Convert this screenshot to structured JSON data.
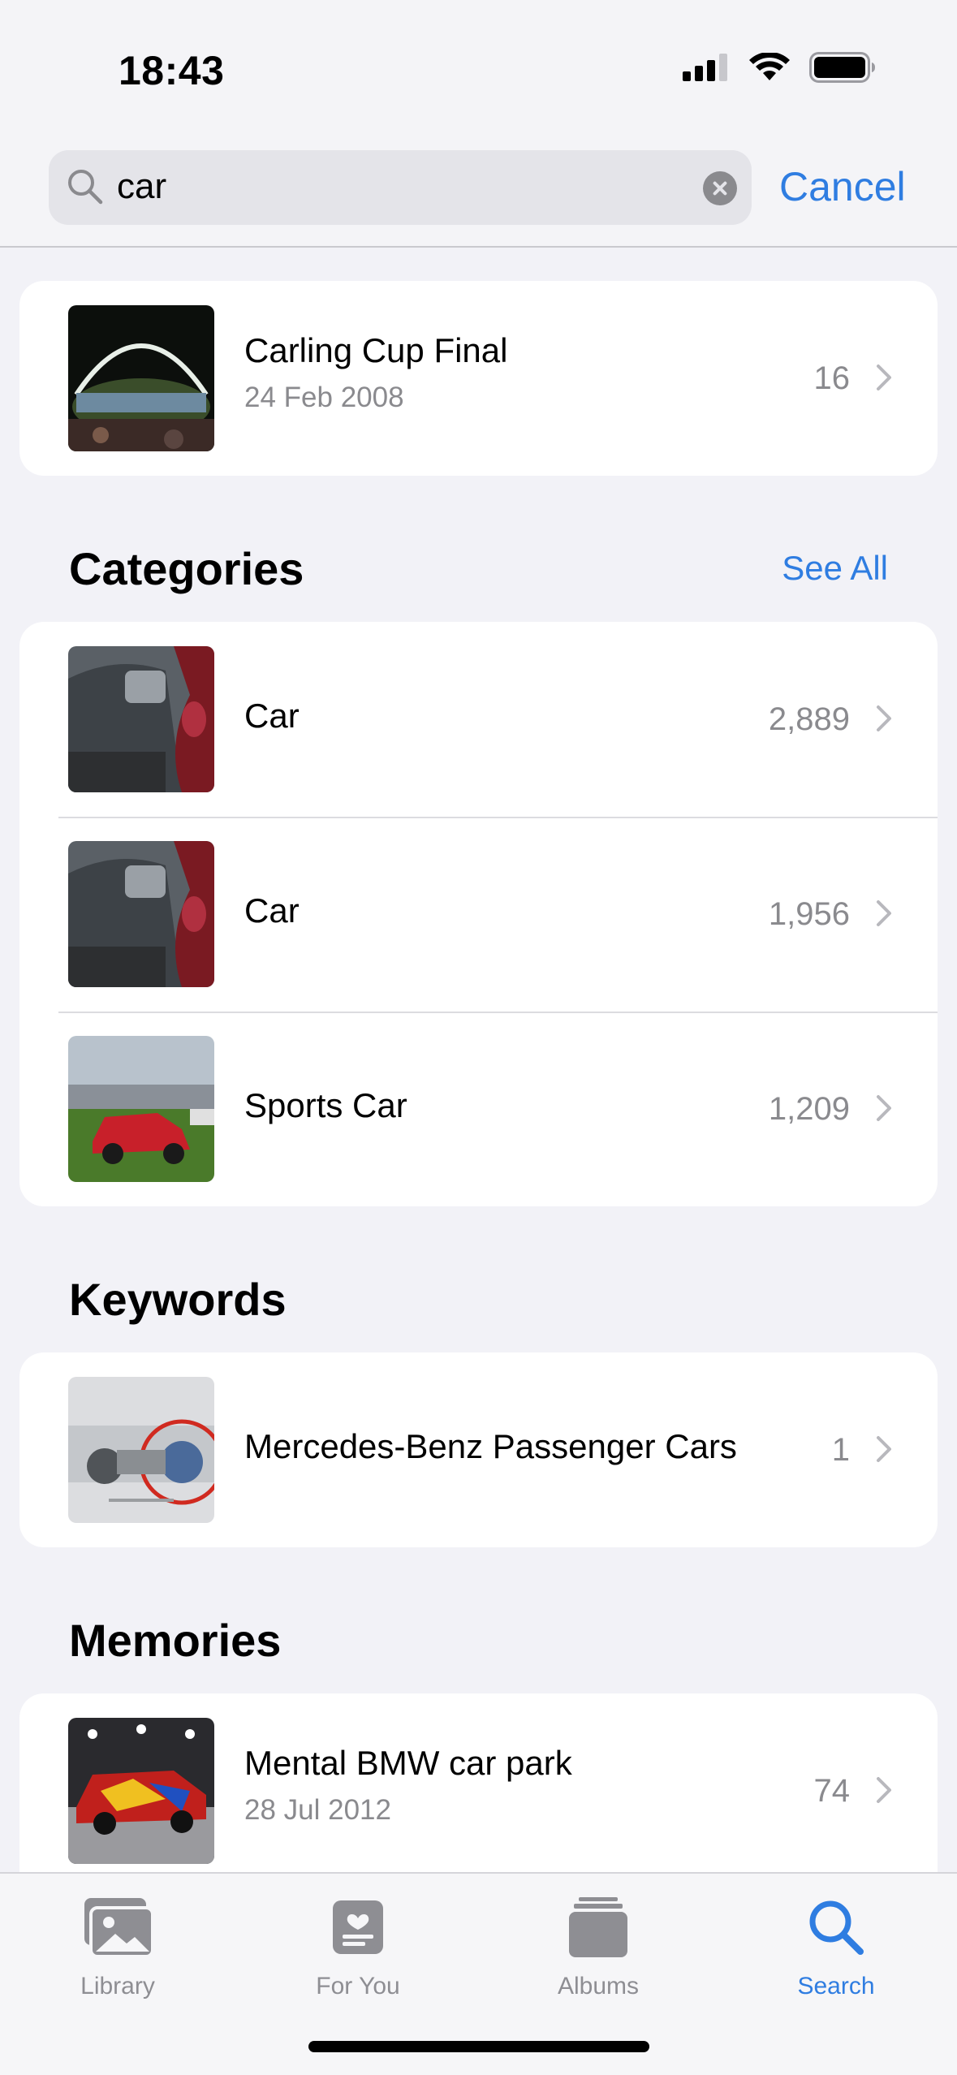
{
  "status": {
    "time": "18:43"
  },
  "search": {
    "query": "car",
    "cancel_label": "Cancel"
  },
  "top_result": {
    "title": "Carling Cup Final",
    "date": "24 Feb 2008",
    "count": "16"
  },
  "categories": {
    "title": "Categories",
    "see_all": "See All",
    "items": [
      {
        "label": "Car",
        "count": "2,889"
      },
      {
        "label": "Car",
        "count": "1,956"
      },
      {
        "label": "Sports Car",
        "count": "1,209"
      }
    ]
  },
  "keywords": {
    "title": "Keywords",
    "items": [
      {
        "label": "Mercedes-Benz Passenger Cars",
        "count": "1"
      }
    ]
  },
  "memories": {
    "title": "Memories",
    "items": [
      {
        "title": "Mental BMW car park",
        "date": "28 Jul 2012",
        "count": "74"
      }
    ]
  },
  "tabs": [
    {
      "label": "Library",
      "icon": "photo-library-icon"
    },
    {
      "label": "For You",
      "icon": "for-you-icon"
    },
    {
      "label": "Albums",
      "icon": "albums-icon"
    },
    {
      "label": "Search",
      "icon": "search-icon",
      "active": true
    }
  ],
  "colors": {
    "accent": "#2f7de1",
    "background": "#f2f2f7",
    "secondary_text": "#8a8a8e"
  }
}
